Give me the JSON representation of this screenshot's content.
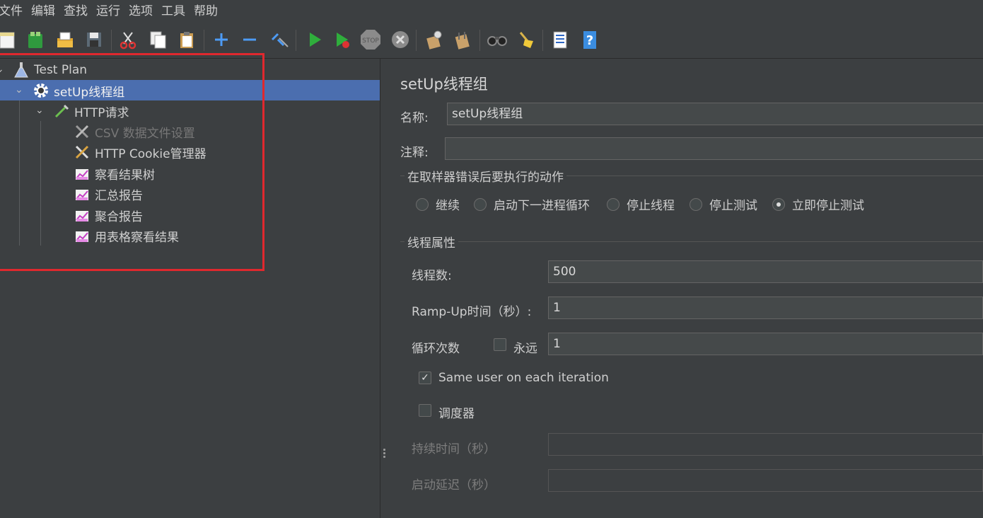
{
  "menu": [
    "文件",
    "编辑",
    "查找",
    "运行",
    "选项",
    "工具",
    "帮助"
  ],
  "toolbar": {
    "icons": [
      "new-icon",
      "templates-icon",
      "open-icon",
      "save-icon",
      "cut-icon",
      "copy-icon",
      "paste-icon",
      "expand-icon",
      "collapse-icon",
      "toggle-icon",
      "start-icon",
      "start-no-pause-icon",
      "stop-icon",
      "shutdown-icon",
      "clear-icon",
      "clear-all-icon",
      "search-icon",
      "reset-search-icon",
      "function-helper-icon",
      "help-icon"
    ],
    "stop_label": "STOP"
  },
  "tree": {
    "nodes": [
      {
        "label": "Test Plan",
        "icon": "test-plan-flask-icon"
      },
      {
        "label": "setUp线程组",
        "icon": "gear-icon"
      },
      {
        "label": "HTTP请求",
        "icon": "pipette-icon"
      },
      {
        "label": "CSV 数据文件设置",
        "icon": "tools-icon"
      },
      {
        "label": "HTTP Cookie管理器",
        "icon": "tools-icon"
      },
      {
        "label": "察看结果树",
        "icon": "graph-icon"
      },
      {
        "label": "汇总报告",
        "icon": "graph-icon"
      },
      {
        "label": "聚合报告",
        "icon": "graph-icon"
      },
      {
        "label": "用表格察看结果",
        "icon": "graph-icon"
      }
    ],
    "selected": "setUp线程组"
  },
  "panel": {
    "title": "setUp线程组",
    "name_label": "名称:",
    "name_value": "setUp线程组",
    "comment_label": "注释:",
    "comment_value": "",
    "on_error_title": "在取样器错误后要执行的动作",
    "on_error_options": [
      "继续",
      "启动下一进程循环",
      "停止线程",
      "停止测试",
      "立即停止测试"
    ],
    "on_error_selected": "立即停止测试",
    "thread_props_title": "线程属性",
    "threads_label": "线程数:",
    "threads_value": "500",
    "rampup_label": "Ramp-Up时间（秒）:",
    "rampup_value": "1",
    "loop_label": "循环次数",
    "forever_label": "永远",
    "forever_checked": false,
    "loop_value": "1",
    "same_user_label": "Same user on each iteration",
    "same_user_checked": true,
    "scheduler_label": "调度器",
    "scheduler_checked": false,
    "duration_label": "持续时间（秒）",
    "delay_label": "启动延迟（秒）"
  }
}
